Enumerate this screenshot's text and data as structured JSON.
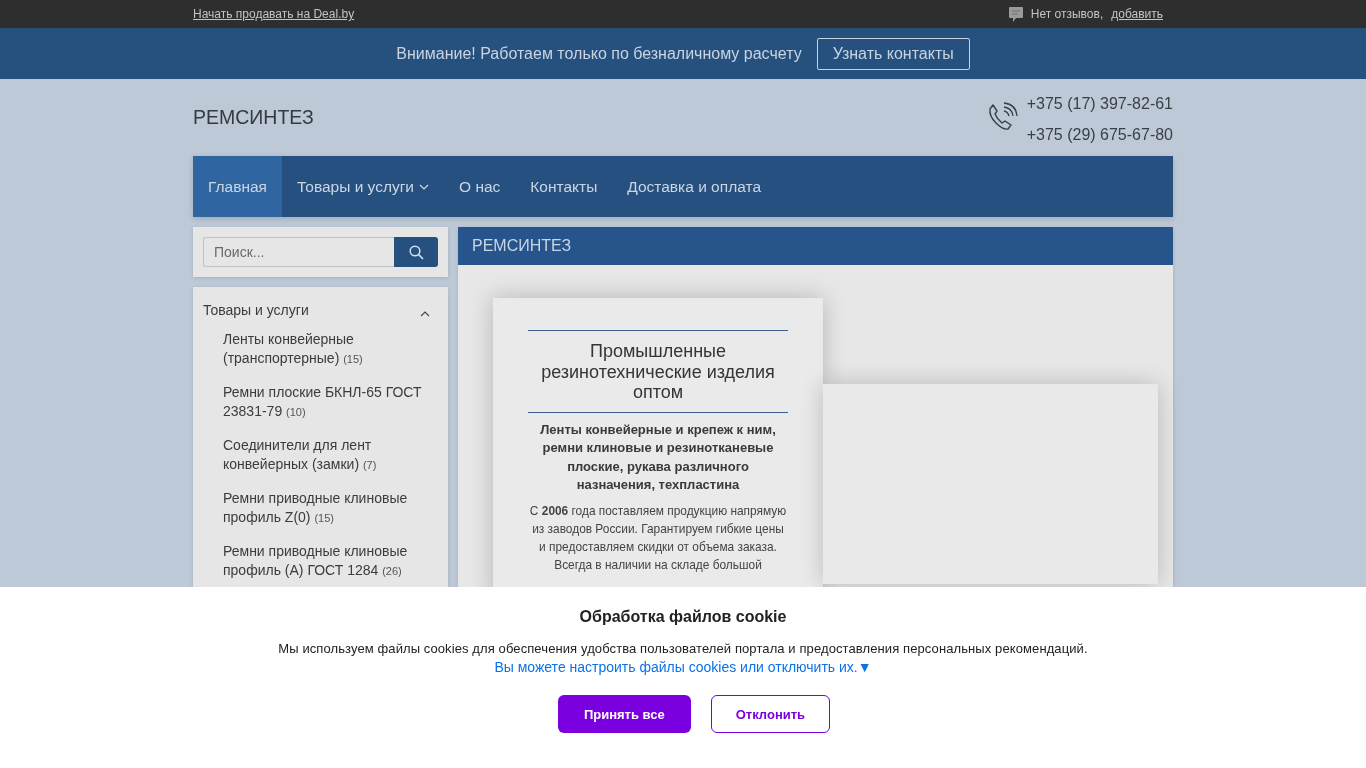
{
  "top_bar": {
    "seller_link": "Начать продавать на Deal.by",
    "reviews_text": "Нет отзывов,",
    "reviews_link": "добавить"
  },
  "notice": {
    "text": "Внимание! Работаем только по безналичному расчету",
    "button": "Узнать контакты"
  },
  "header": {
    "logo": "РЕМСИНТЕЗ",
    "phones": [
      "+375 (17) 397-82-61",
      "+375 (29) 675-67-80"
    ]
  },
  "nav": [
    {
      "label": "Главная",
      "selected": true,
      "dropdown": false
    },
    {
      "label": "Товары и услуги",
      "selected": false,
      "dropdown": true
    },
    {
      "label": "О нас",
      "selected": false,
      "dropdown": false
    },
    {
      "label": "Контакты",
      "selected": false,
      "dropdown": false
    },
    {
      "label": "Доставка и оплата",
      "selected": false,
      "dropdown": false
    }
  ],
  "sidebar": {
    "search": {
      "placeholder": "Поиск..."
    },
    "catalog": {
      "title": "Товары и услуги",
      "expanded": true,
      "items": [
        {
          "label": "Ленты конвейерные (транспортерные)",
          "count": "(15)"
        },
        {
          "label": "Ремни плоские БКНЛ-65 ГОСТ 23831-79",
          "count": "(10)"
        },
        {
          "label": "Соединители для лент конвейерных (замки)",
          "count": "(7)"
        },
        {
          "label": "Ремни приводные клиновые профиль Z(0)",
          "count": "(15)"
        },
        {
          "label": "Ремни приводные клиновые профиль (А) ГОСТ 1284",
          "count": "(26)"
        }
      ]
    }
  },
  "content": {
    "title": "РЕМСИНТЕЗ",
    "promo": {
      "heading": "Промышленные резинотехнические изделия оптом",
      "subheading": "Ленты конвейерные и крепеж к ним, ремни клиновые и резинотканевые плоские, рукава различного назначения, техпластина",
      "text": "С **2006** года поставляем продукцию напрямую из заводов России. Гарантируем гибкие цены и предоставляем скидки от объема заказа. Всегда в наличии на складе большой"
    }
  },
  "cookie_banner": {
    "title": "Обработка файлов cookie",
    "text": "Мы используем файлы cookies для обеспечения удобства пользователей портала и предоставления персональных рекомендаций.",
    "link": "Вы можете настроить файлы cookies или отключить их.▼",
    "buttons": [
      {
        "label": "Принять все",
        "kind": "primary"
      },
      {
        "label": "Отклонить",
        "kind": "secondary"
      }
    ]
  }
}
